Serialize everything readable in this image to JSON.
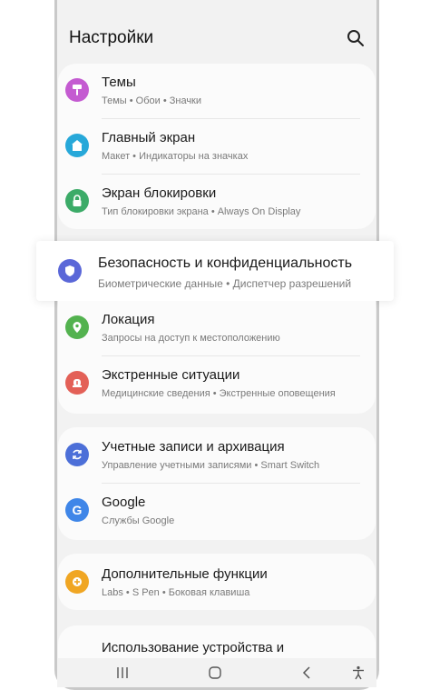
{
  "header": {
    "title": "Настройки",
    "search_icon": "search-icon"
  },
  "colors": {
    "themes": "#c45bd1",
    "home": "#27a8d9",
    "lock": "#3cab68",
    "security": "#5a67d8",
    "location": "#53b24f",
    "emergency": "#e36057",
    "accounts": "#4c6fd8",
    "google": "#3f86e8",
    "advanced": "#f0a623"
  },
  "items": [
    {
      "title": "Темы",
      "subtitle": "Темы  •  Обои  •  Значки",
      "icon": "brush-icon"
    },
    {
      "title": "Главный экран",
      "subtitle": "Макет  •  Индикаторы на значках",
      "icon": "home-icon"
    },
    {
      "title": "Экран блокировки",
      "subtitle": "Тип блокировки экрана  •  Always On Display",
      "icon": "lock-icon"
    },
    {
      "title": "Безопасность и конфиденциальность",
      "subtitle": "Биометрические данные  •  Диспетчер разрешений",
      "icon": "shield-icon"
    },
    {
      "title": "Локация",
      "subtitle": "Запросы на доступ к местоположению",
      "icon": "location-pin-icon"
    },
    {
      "title": "Экстренные ситуации",
      "subtitle": "Медицинские сведения  •  Экстренные оповещения",
      "icon": "emergency-icon"
    },
    {
      "title": "Учетные записи и архивация",
      "subtitle": "Управление учетными записями  •  Smart Switch",
      "icon": "sync-icon"
    },
    {
      "title": "Google",
      "subtitle": "Службы Google",
      "icon": "google-icon"
    },
    {
      "title": "Дополнительные функции",
      "subtitle": "Labs  •  S Pen  •  Боковая клавиша",
      "icon": "gear-plus-icon"
    },
    {
      "title": "Использование устройства и",
      "subtitle": "",
      "icon": ""
    }
  ],
  "navbar": {
    "recents": "recents-icon",
    "home": "home-button-icon",
    "back": "back-icon",
    "accessibility": "accessibility-icon"
  }
}
